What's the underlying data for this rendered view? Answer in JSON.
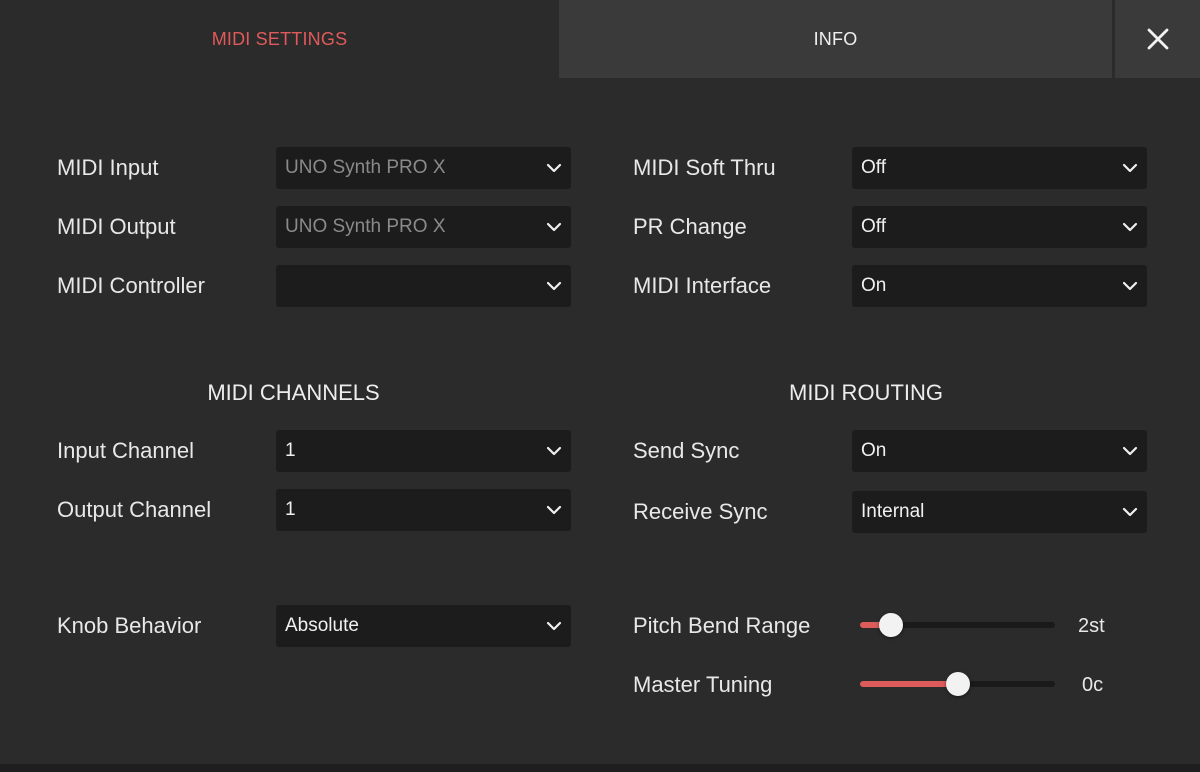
{
  "tabs": {
    "midi_settings": "MIDI SETTINGS",
    "info": "INFO"
  },
  "general": {
    "midi_input": {
      "label": "MIDI Input",
      "value": "UNO Synth PRO X"
    },
    "midi_output": {
      "label": "MIDI Output",
      "value": "UNO Synth PRO X"
    },
    "midi_controller": {
      "label": "MIDI Controller",
      "value": ""
    },
    "midi_soft_thru": {
      "label": "MIDI Soft Thru",
      "value": "Off"
    },
    "pr_change": {
      "label": "PR Change",
      "value": "Off"
    },
    "midi_interface": {
      "label": "MIDI Interface",
      "value": "On"
    }
  },
  "midi_channels": {
    "title": "MIDI CHANNELS",
    "input_channel": {
      "label": "Input Channel",
      "value": "1"
    },
    "output_channel": {
      "label": "Output Channel",
      "value": "1"
    }
  },
  "midi_routing": {
    "title": "MIDI ROUTING",
    "send_sync": {
      "label": "Send Sync",
      "value": "On"
    },
    "receive_sync": {
      "label": "Receive Sync",
      "value": "Internal"
    }
  },
  "knob_behavior": {
    "label": "Knob Behavior",
    "value": "Absolute"
  },
  "pitch_bend_range": {
    "label": "Pitch Bend Range",
    "value": "2st",
    "level": 0.16
  },
  "master_tuning": {
    "label": "Master Tuning",
    "value": "0c",
    "level": 0.5
  },
  "colors": {
    "accent": "#e05a5a",
    "background": "#2b2b2b",
    "tab_inactive": "#3a3a3a",
    "field": "#1c1c1c"
  },
  "icons": {
    "close": "close-icon",
    "dropdown": "chevron-down-icon"
  }
}
